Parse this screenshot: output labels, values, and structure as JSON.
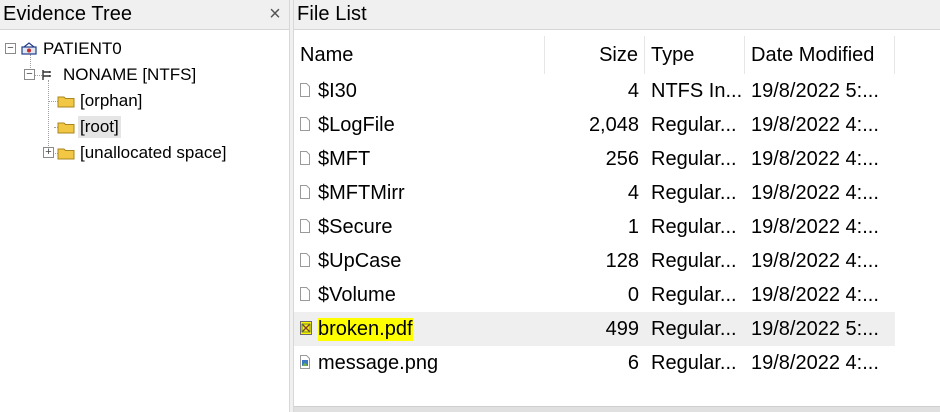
{
  "evidence_tree": {
    "title": "Evidence Tree",
    "close_glyph": "×",
    "nodes": [
      {
        "label": "PATIENT0",
        "icon": "evidence-drive-icon",
        "expander": "−"
      },
      {
        "label": "NONAME [NTFS]",
        "icon": "partition-icon",
        "expander": "−"
      },
      {
        "label": "[orphan]",
        "icon": "folder-icon"
      },
      {
        "label": "[root]",
        "icon": "folder-icon",
        "expander": "+",
        "selected": true
      },
      {
        "label": "[unallocated space]",
        "icon": "folder-icon"
      }
    ]
  },
  "file_list": {
    "title": "File List",
    "columns": {
      "name": "Name",
      "size": "Size",
      "type": "Type",
      "date": "Date Modified"
    },
    "rows": [
      {
        "name": "$I30",
        "size": "4",
        "type": "NTFS In...",
        "date": "19/8/2022 5:...",
        "icon": "file-icon"
      },
      {
        "name": "$LogFile",
        "size": "2,048",
        "type": "Regular...",
        "date": "19/8/2022 4:...",
        "icon": "file-icon"
      },
      {
        "name": "$MFT",
        "size": "256",
        "type": "Regular...",
        "date": "19/8/2022 4:...",
        "icon": "file-icon"
      },
      {
        "name": "$MFTMirr",
        "size": "4",
        "type": "Regular...",
        "date": "19/8/2022 4:...",
        "icon": "file-icon"
      },
      {
        "name": "$Secure",
        "size": "1",
        "type": "Regular...",
        "date": "19/8/2022 4:...",
        "icon": "file-icon"
      },
      {
        "name": "$UpCase",
        "size": "128",
        "type": "Regular...",
        "date": "19/8/2022 4:...",
        "icon": "file-icon"
      },
      {
        "name": "$Volume",
        "size": "0",
        "type": "Regular...",
        "date": "19/8/2022 4:...",
        "icon": "file-icon"
      },
      {
        "name": "broken.pdf",
        "size": "499",
        "type": "Regular...",
        "date": "19/8/2022 5:...",
        "icon": "broken-file-icon",
        "highlighted": true
      },
      {
        "name": "message.png",
        "size": "6",
        "type": "Regular...",
        "date": "19/8/2022 4:...",
        "icon": "image-file-icon"
      }
    ]
  },
  "colors": {
    "header_bg": "#f0f0f0",
    "highlight_marker": "#ffff00",
    "row_highlight": "#efefef",
    "folder": "#f2c744"
  }
}
